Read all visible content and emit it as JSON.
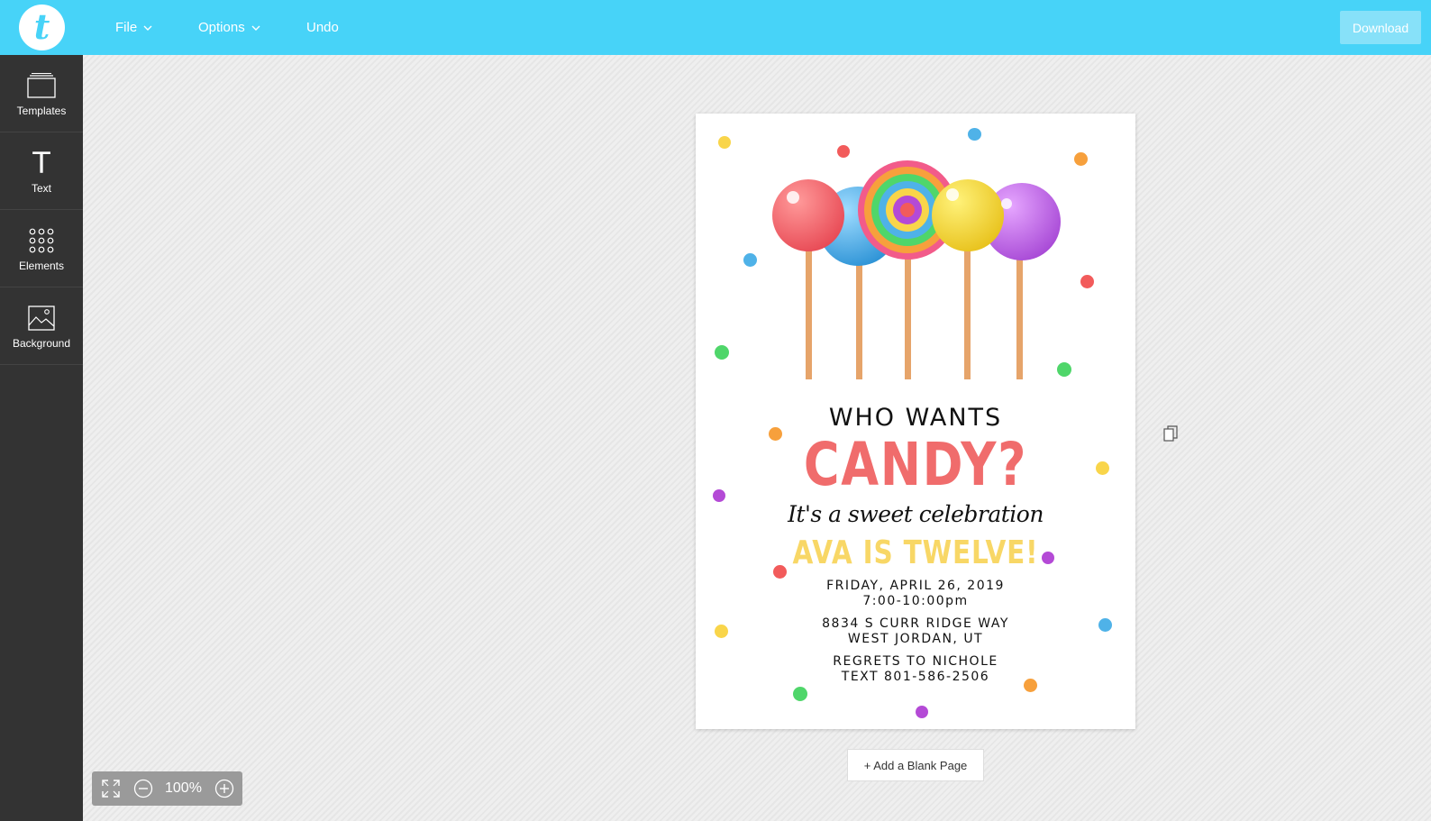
{
  "topbar": {
    "logo_letter": "t",
    "menu": {
      "file": "File",
      "options": "Options",
      "undo": "Undo"
    },
    "download_label": "Download",
    "accent_color": "#47d3f8"
  },
  "sidebar": {
    "items": [
      {
        "label": "Templates",
        "icon": "templates-icon"
      },
      {
        "label": "Text",
        "icon": "text-icon"
      },
      {
        "label": "Elements",
        "icon": "elements-icon"
      },
      {
        "label": "Background",
        "icon": "background-icon"
      }
    ]
  },
  "invitation": {
    "line1": "WHO WANTS",
    "line2": "CANDY?",
    "line3": "It's a sweet celebration",
    "line4": "AVA IS TWELVE!",
    "date": "FRIDAY, APRIL 26, 2019",
    "time": "7:00-10:00pm",
    "address1": "8834 S CURR RIDGE WAY",
    "address2": "WEST JORDAN, UT",
    "regrets": "REGRETS TO NICHOLE",
    "phone": "TEXT 801-586-2506"
  },
  "canvas": {
    "add_page_label": "+ Add a Blank Page"
  },
  "zoom": {
    "level": "100%"
  }
}
